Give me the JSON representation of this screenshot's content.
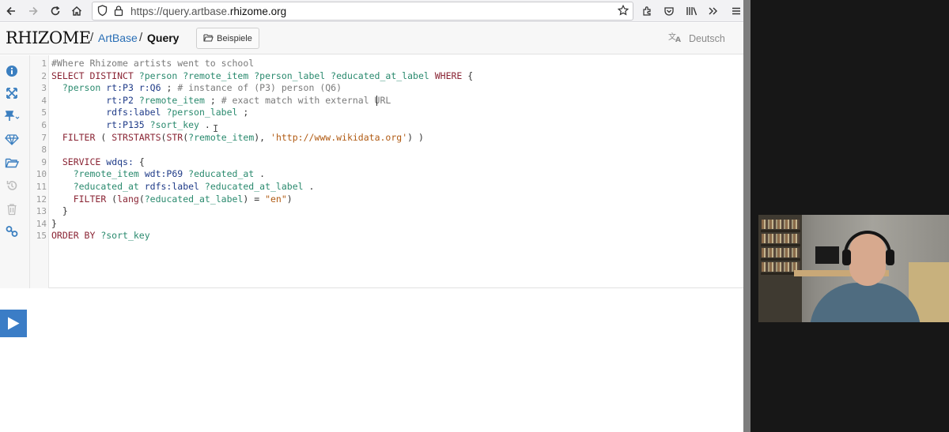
{
  "browser": {
    "url_prefix": "https://query.artbase.",
    "url_domain": "rhizome.org",
    "icons": [
      "back-icon",
      "forward-icon",
      "reload-icon",
      "home-icon",
      "shield-icon",
      "lock-icon",
      "bookmark-star-icon",
      "extension-icon",
      "pocket-icon",
      "library-icon",
      "overflow-icon",
      "menu-icon"
    ]
  },
  "header": {
    "logo": "RHIZOME",
    "sep1": "/",
    "artbase": "ArtBase",
    "sep2": "/",
    "query": "Query",
    "examples_label": "Beispiele",
    "language_label": "Deutsch"
  },
  "sidebar": {
    "icons": [
      "info-icon",
      "expand-icon",
      "pin-icon",
      "gem-icon",
      "folder-open-icon",
      "history-icon",
      "trash-icon",
      "link-icon"
    ],
    "run_label": "Run"
  },
  "editor": {
    "line_numbers": [
      "1",
      "2",
      "3",
      "4",
      "5",
      "6",
      "7",
      "8",
      "9",
      "10",
      "11",
      "12",
      "13",
      "14",
      "15"
    ],
    "lines": [
      [
        [
          "cm",
          "#Where Rhizome artists went to school"
        ]
      ],
      [
        [
          "kw",
          "SELECT DISTINCT "
        ],
        [
          "var",
          "?person"
        ],
        [
          "punc",
          " "
        ],
        [
          "var",
          "?remote_item"
        ],
        [
          "punc",
          " "
        ],
        [
          "var",
          "?person_label"
        ],
        [
          "punc",
          " "
        ],
        [
          "var",
          "?educated_at_label"
        ],
        [
          "punc",
          " "
        ],
        [
          "kw",
          "WHERE"
        ],
        [
          "punc",
          " {"
        ]
      ],
      [
        [
          "punc",
          "  "
        ],
        [
          "var",
          "?person"
        ],
        [
          "punc",
          " "
        ],
        [
          "pre",
          "rt:P3"
        ],
        [
          "punc",
          " "
        ],
        [
          "pre",
          "r:Q6"
        ],
        [
          "punc",
          " ; "
        ],
        [
          "cm",
          "# instance of (P3) person (Q6)"
        ]
      ],
      [
        [
          "punc",
          "          "
        ],
        [
          "pre",
          "rt:P2"
        ],
        [
          "punc",
          " "
        ],
        [
          "var",
          "?remote_item"
        ],
        [
          "punc",
          " ; "
        ],
        [
          "cm",
          "# exact match with external URL"
        ]
      ],
      [
        [
          "punc",
          "          "
        ],
        [
          "pre",
          "rdfs:label"
        ],
        [
          "punc",
          " "
        ],
        [
          "var",
          "?person_label"
        ],
        [
          "punc",
          " ;"
        ]
      ],
      [
        [
          "punc",
          "          "
        ],
        [
          "pre",
          "rt:P135"
        ],
        [
          "punc",
          " "
        ],
        [
          "var",
          "?sort_key"
        ],
        [
          "punc",
          " ."
        ]
      ],
      [
        [
          "punc",
          "  "
        ],
        [
          "kw",
          "FILTER"
        ],
        [
          "punc",
          " ( "
        ],
        [
          "fn",
          "STRSTARTS"
        ],
        [
          "punc",
          "("
        ],
        [
          "fn",
          "STR"
        ],
        [
          "punc",
          "("
        ],
        [
          "var",
          "?remote_item"
        ],
        [
          "punc",
          "), "
        ],
        [
          "str",
          "'http://www.wikidata.org'"
        ],
        [
          "punc",
          ") )"
        ]
      ],
      [
        [
          "punc",
          ""
        ]
      ],
      [
        [
          "punc",
          "  "
        ],
        [
          "kw",
          "SERVICE"
        ],
        [
          "punc",
          " "
        ],
        [
          "pre",
          "wdqs:"
        ],
        [
          "punc",
          " {"
        ]
      ],
      [
        [
          "punc",
          "    "
        ],
        [
          "var",
          "?remote_item"
        ],
        [
          "punc",
          " "
        ],
        [
          "pre",
          "wdt:P69"
        ],
        [
          "punc",
          " "
        ],
        [
          "var",
          "?educated_at"
        ],
        [
          "punc",
          " ."
        ]
      ],
      [
        [
          "punc",
          "    "
        ],
        [
          "var",
          "?educated_at"
        ],
        [
          "punc",
          " "
        ],
        [
          "pre",
          "rdfs:label"
        ],
        [
          "punc",
          " "
        ],
        [
          "var",
          "?educated_at_label"
        ],
        [
          "punc",
          " ."
        ]
      ],
      [
        [
          "punc",
          "    "
        ],
        [
          "kw",
          "FILTER"
        ],
        [
          "punc",
          " ("
        ],
        [
          "fn",
          "lang"
        ],
        [
          "punc",
          "("
        ],
        [
          "var",
          "?educated_at_label"
        ],
        [
          "punc",
          ") = "
        ],
        [
          "str",
          "\"en\""
        ],
        [
          "punc",
          ")"
        ]
      ],
      [
        [
          "punc",
          "  }"
        ]
      ],
      [
        [
          "punc",
          "}"
        ]
      ],
      [
        [
          "kw",
          "ORDER BY"
        ],
        [
          "punc",
          " "
        ],
        [
          "var",
          "?sort_key"
        ]
      ]
    ]
  },
  "colors": {
    "accent": "#3b7dc6",
    "keyword": "#8a2434",
    "variable": "#2a8a6e",
    "prefix": "#1f3b88",
    "comment": "#7a7a7a",
    "string": "#b05a12"
  }
}
